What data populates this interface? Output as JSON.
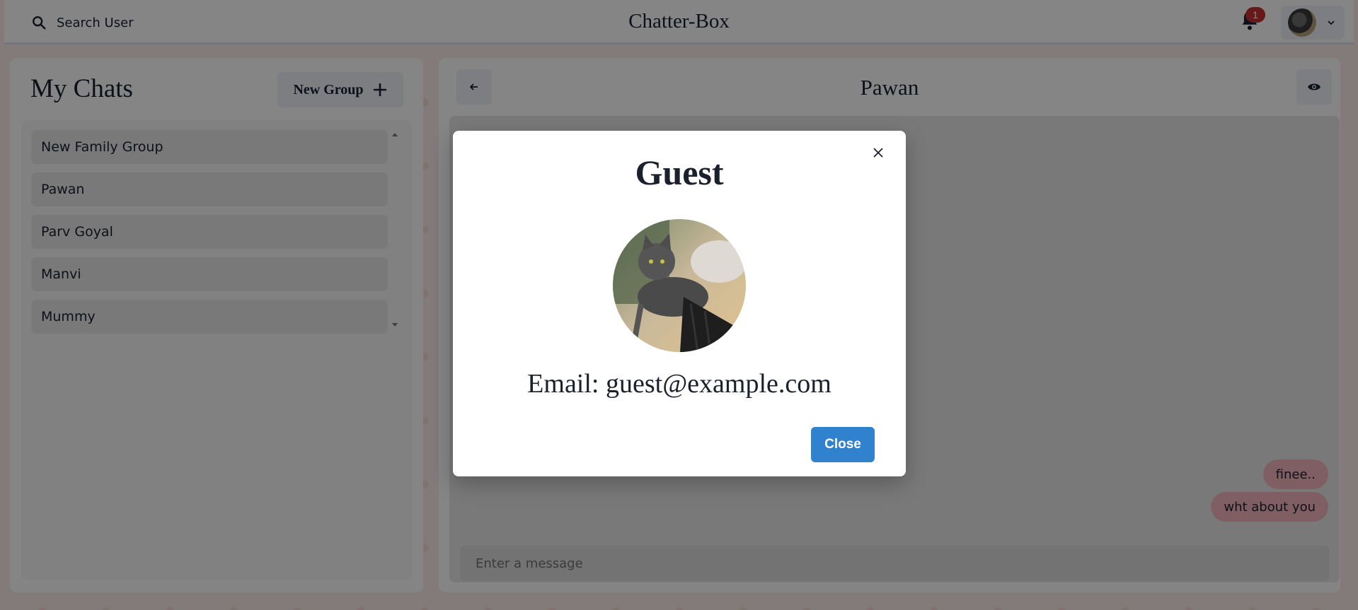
{
  "header": {
    "search_label": "Search User",
    "app_title": "Chatter-Box",
    "notification_count": "1"
  },
  "sidebar": {
    "title": "My Chats",
    "new_group_label": "New Group",
    "chats": [
      "New Family Group",
      "Pawan",
      "Parv Goyal",
      "Manvi",
      "Mummy"
    ]
  },
  "chat": {
    "title": "Pawan",
    "messages": [
      "finee..",
      "wht about you"
    ],
    "input_placeholder": "Enter a message"
  },
  "modal": {
    "title": "Guest",
    "email_text": "Email: guest@example.com",
    "close_label": "Close"
  },
  "colors": {
    "accent": "#3182ce",
    "badge": "#c53030",
    "message_bubble": "#f4b6be"
  }
}
